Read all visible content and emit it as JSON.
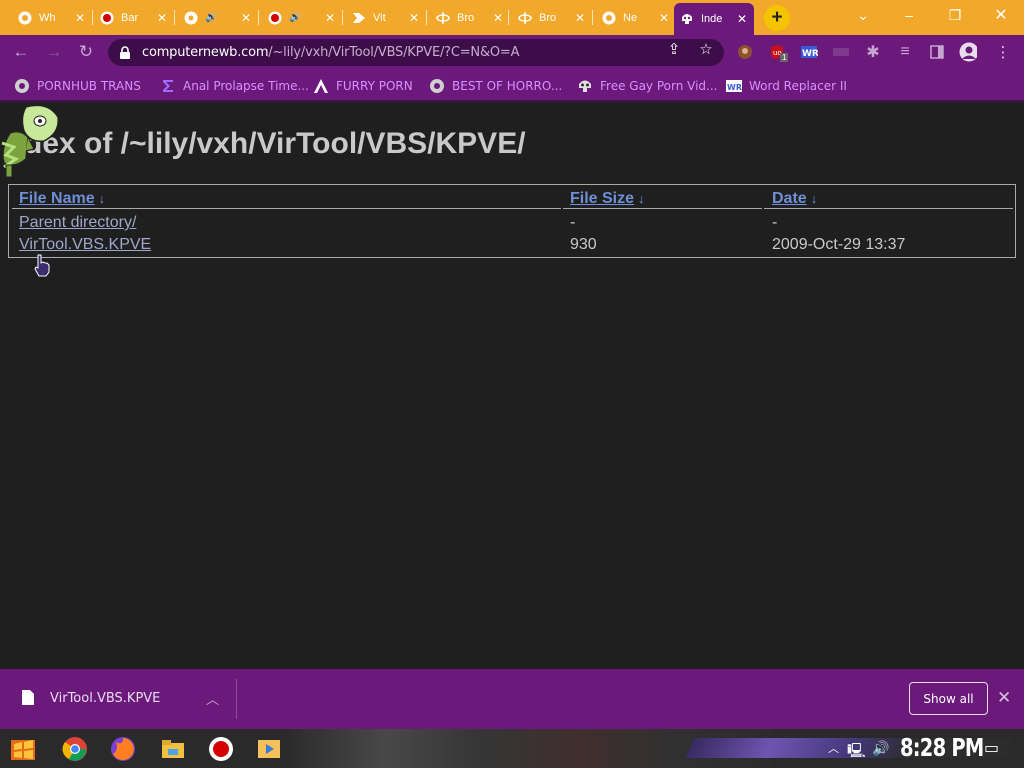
{
  "browser": {
    "tabs": [
      {
        "title": "Wh",
        "icon": "chrome-icon",
        "active": false
      },
      {
        "title": "Bar",
        "icon": "record-icon",
        "active": false
      },
      {
        "title": "",
        "icon": "globe-icon",
        "audio": true,
        "active": false
      },
      {
        "title": "",
        "icon": "record-icon",
        "audio": true,
        "active": false
      },
      {
        "title": "Vit",
        "icon": "video-icon",
        "active": false
      },
      {
        "title": "Bro",
        "icon": "brush-icon",
        "active": false
      },
      {
        "title": "Bro",
        "icon": "brush-icon",
        "active": false
      },
      {
        "title": "Ne",
        "icon": "chrome-icon",
        "active": false
      },
      {
        "title": "Inde",
        "icon": "skull-icon",
        "active": true
      }
    ],
    "url_domain": "computernewb.com",
    "url_path": "/~lily/vxh/VirTool/VBS/KPVE/?C=N&O=A",
    "bookmarks": [
      {
        "label": "PORNHUB TRANS",
        "icon": "globe-icon"
      },
      {
        "label": "Anal Prolapse Time...",
        "icon": "sigma-icon"
      },
      {
        "label": "FURRY PORN",
        "icon": "arch-icon"
      },
      {
        "label": "BEST OF HORRO...",
        "icon": "globe-icon"
      },
      {
        "label": "Free Gay Porn Vid...",
        "icon": "skull-icon"
      },
      {
        "label": "Word Replacer II",
        "icon": "wr-icon"
      }
    ],
    "extension_badge": "1"
  },
  "page": {
    "heading": "dex of /~lily/vxh/VirTool/VBS/KPVE/",
    "columns": {
      "name": "File Name",
      "size": "File Size",
      "date": "Date",
      "sort_arrow": "↓"
    },
    "rows": [
      {
        "name": "Parent directory/",
        "size": "-",
        "date": "-"
      },
      {
        "name": "VirTool.VBS.KPVE",
        "size": "930",
        "date": "2009-Oct-29 13:37"
      }
    ]
  },
  "downloads": {
    "file": "VirTool.VBS.KPVE",
    "show_all": "Show all"
  },
  "taskbar": {
    "clock": "8:28 PM"
  },
  "colors": {
    "tab_strip": "#f2a82a",
    "chrome_purple": "#6b1a7c",
    "page_bg": "#1f1f1f",
    "link": "#6f8fd6",
    "bookmark_text": "#d98fff"
  }
}
